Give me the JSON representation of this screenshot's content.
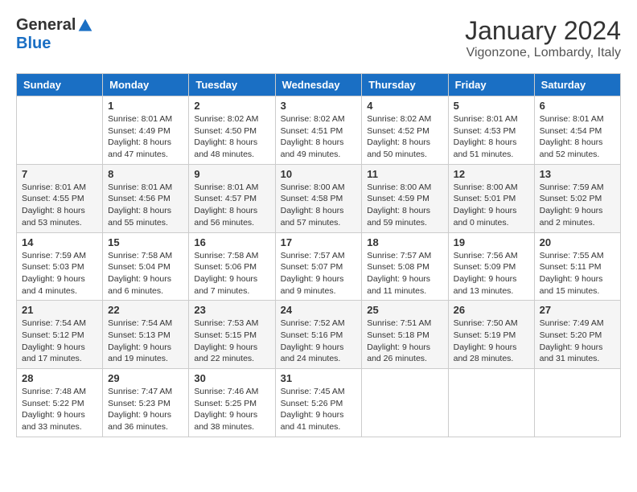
{
  "header": {
    "logo_general": "General",
    "logo_blue": "Blue",
    "title": "January 2024",
    "location": "Vigonzone, Lombardy, Italy"
  },
  "days_of_week": [
    "Sunday",
    "Monday",
    "Tuesday",
    "Wednesday",
    "Thursday",
    "Friday",
    "Saturday"
  ],
  "weeks": [
    [
      {
        "day": "",
        "info": ""
      },
      {
        "day": "1",
        "info": "Sunrise: 8:01 AM\nSunset: 4:49 PM\nDaylight: 8 hours\nand 47 minutes."
      },
      {
        "day": "2",
        "info": "Sunrise: 8:02 AM\nSunset: 4:50 PM\nDaylight: 8 hours\nand 48 minutes."
      },
      {
        "day": "3",
        "info": "Sunrise: 8:02 AM\nSunset: 4:51 PM\nDaylight: 8 hours\nand 49 minutes."
      },
      {
        "day": "4",
        "info": "Sunrise: 8:02 AM\nSunset: 4:52 PM\nDaylight: 8 hours\nand 50 minutes."
      },
      {
        "day": "5",
        "info": "Sunrise: 8:01 AM\nSunset: 4:53 PM\nDaylight: 8 hours\nand 51 minutes."
      },
      {
        "day": "6",
        "info": "Sunrise: 8:01 AM\nSunset: 4:54 PM\nDaylight: 8 hours\nand 52 minutes."
      }
    ],
    [
      {
        "day": "7",
        "info": "Sunrise: 8:01 AM\nSunset: 4:55 PM\nDaylight: 8 hours\nand 53 minutes."
      },
      {
        "day": "8",
        "info": "Sunrise: 8:01 AM\nSunset: 4:56 PM\nDaylight: 8 hours\nand 55 minutes."
      },
      {
        "day": "9",
        "info": "Sunrise: 8:01 AM\nSunset: 4:57 PM\nDaylight: 8 hours\nand 56 minutes."
      },
      {
        "day": "10",
        "info": "Sunrise: 8:00 AM\nSunset: 4:58 PM\nDaylight: 8 hours\nand 57 minutes."
      },
      {
        "day": "11",
        "info": "Sunrise: 8:00 AM\nSunset: 4:59 PM\nDaylight: 8 hours\nand 59 minutes."
      },
      {
        "day": "12",
        "info": "Sunrise: 8:00 AM\nSunset: 5:01 PM\nDaylight: 9 hours\nand 0 minutes."
      },
      {
        "day": "13",
        "info": "Sunrise: 7:59 AM\nSunset: 5:02 PM\nDaylight: 9 hours\nand 2 minutes."
      }
    ],
    [
      {
        "day": "14",
        "info": "Sunrise: 7:59 AM\nSunset: 5:03 PM\nDaylight: 9 hours\nand 4 minutes."
      },
      {
        "day": "15",
        "info": "Sunrise: 7:58 AM\nSunset: 5:04 PM\nDaylight: 9 hours\nand 6 minutes."
      },
      {
        "day": "16",
        "info": "Sunrise: 7:58 AM\nSunset: 5:06 PM\nDaylight: 9 hours\nand 7 minutes."
      },
      {
        "day": "17",
        "info": "Sunrise: 7:57 AM\nSunset: 5:07 PM\nDaylight: 9 hours\nand 9 minutes."
      },
      {
        "day": "18",
        "info": "Sunrise: 7:57 AM\nSunset: 5:08 PM\nDaylight: 9 hours\nand 11 minutes."
      },
      {
        "day": "19",
        "info": "Sunrise: 7:56 AM\nSunset: 5:09 PM\nDaylight: 9 hours\nand 13 minutes."
      },
      {
        "day": "20",
        "info": "Sunrise: 7:55 AM\nSunset: 5:11 PM\nDaylight: 9 hours\nand 15 minutes."
      }
    ],
    [
      {
        "day": "21",
        "info": "Sunrise: 7:54 AM\nSunset: 5:12 PM\nDaylight: 9 hours\nand 17 minutes."
      },
      {
        "day": "22",
        "info": "Sunrise: 7:54 AM\nSunset: 5:13 PM\nDaylight: 9 hours\nand 19 minutes."
      },
      {
        "day": "23",
        "info": "Sunrise: 7:53 AM\nSunset: 5:15 PM\nDaylight: 9 hours\nand 22 minutes."
      },
      {
        "day": "24",
        "info": "Sunrise: 7:52 AM\nSunset: 5:16 PM\nDaylight: 9 hours\nand 24 minutes."
      },
      {
        "day": "25",
        "info": "Sunrise: 7:51 AM\nSunset: 5:18 PM\nDaylight: 9 hours\nand 26 minutes."
      },
      {
        "day": "26",
        "info": "Sunrise: 7:50 AM\nSunset: 5:19 PM\nDaylight: 9 hours\nand 28 minutes."
      },
      {
        "day": "27",
        "info": "Sunrise: 7:49 AM\nSunset: 5:20 PM\nDaylight: 9 hours\nand 31 minutes."
      }
    ],
    [
      {
        "day": "28",
        "info": "Sunrise: 7:48 AM\nSunset: 5:22 PM\nDaylight: 9 hours\nand 33 minutes."
      },
      {
        "day": "29",
        "info": "Sunrise: 7:47 AM\nSunset: 5:23 PM\nDaylight: 9 hours\nand 36 minutes."
      },
      {
        "day": "30",
        "info": "Sunrise: 7:46 AM\nSunset: 5:25 PM\nDaylight: 9 hours\nand 38 minutes."
      },
      {
        "day": "31",
        "info": "Sunrise: 7:45 AM\nSunset: 5:26 PM\nDaylight: 9 hours\nand 41 minutes."
      },
      {
        "day": "",
        "info": ""
      },
      {
        "day": "",
        "info": ""
      },
      {
        "day": "",
        "info": ""
      }
    ]
  ]
}
